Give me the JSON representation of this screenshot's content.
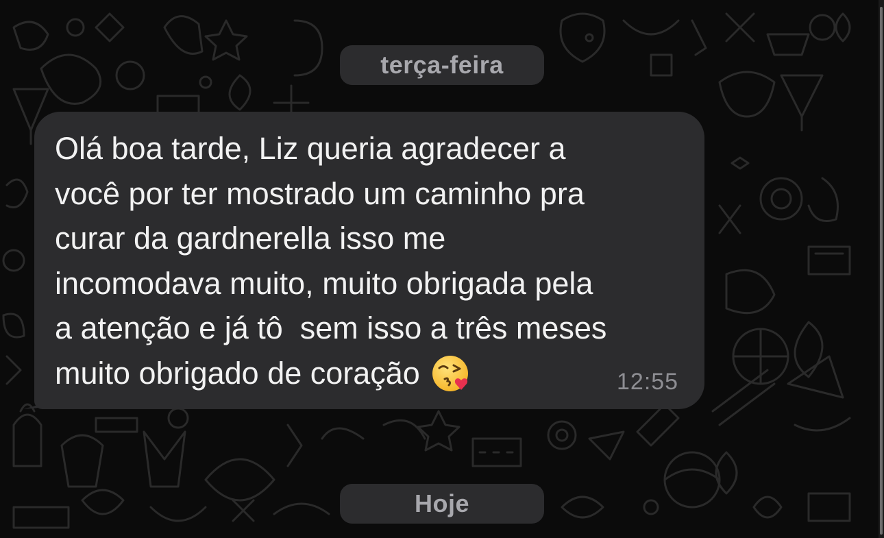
{
  "chat": {
    "date_separators": {
      "previous": "terça-feira",
      "today": "Hoje"
    },
    "message": {
      "lines": [
        "Olá boa tarde, Liz queria agradecer a",
        "você por ter mostrado um caminho pra",
        "curar da gardnerella isso me",
        "incomodava muito, muito obrigada pela",
        "a atenção e já tô  sem isso a três meses",
        "muito obrigado de coração "
      ],
      "emoji": "kissing-heart-emoji",
      "time": "12:55",
      "direction": "incoming"
    }
  },
  "colors": {
    "background": "#0b0b0b",
    "bubble": "#2c2c2e",
    "chip": "#2c2c2e",
    "text": "#f2f2f2",
    "muted": "#8e8e93"
  }
}
